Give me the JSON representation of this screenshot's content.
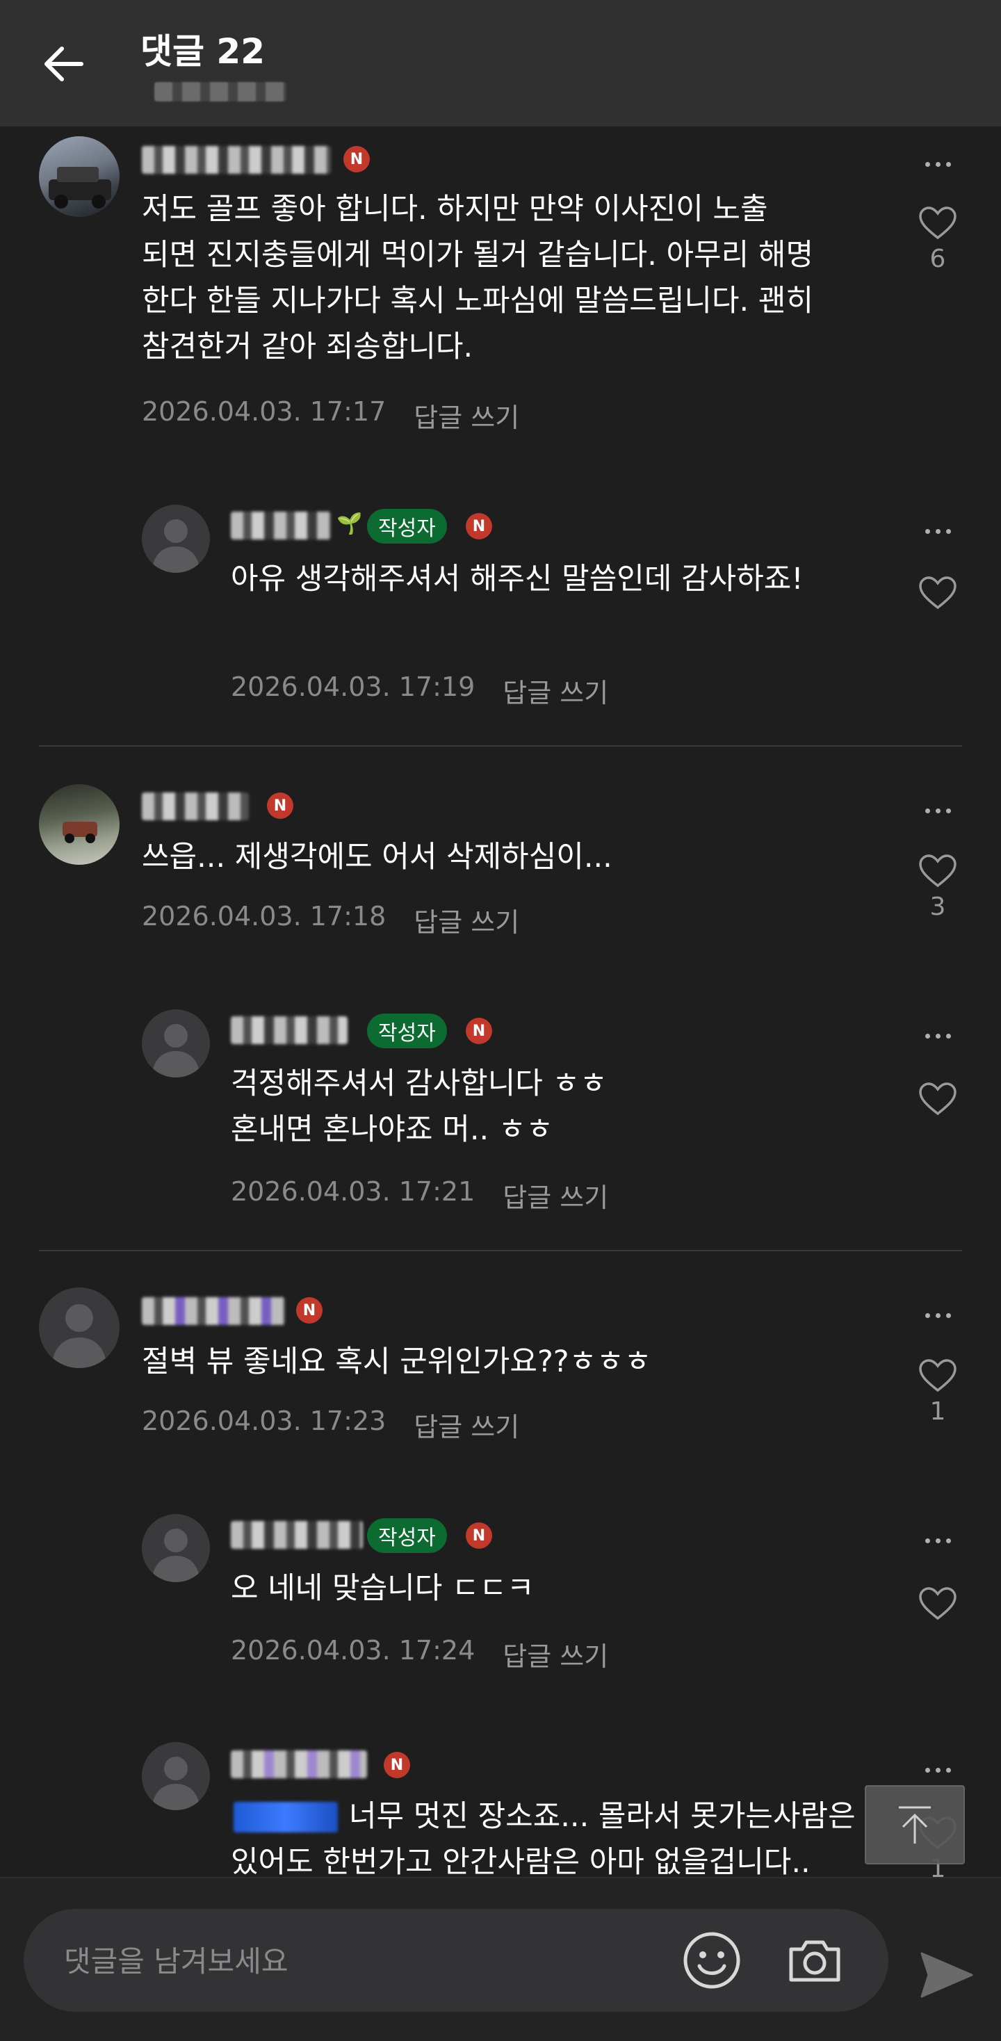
{
  "header": {
    "title": "댓글 22"
  },
  "comments": [
    {
      "text": "저도 골프 좋아 합니다. 하지만 만약 이사진이 노출\n되면 진지충들에게 먹이가 될거 같습니다. 아무리 해명\n한다 한들 지나가다 혹시 노파심에 말씀드립니다. 괜히\n참견한거 같아 죄송합니다.",
      "date": "2026.04.03. 17:17",
      "reply": "답글 쓰기",
      "likes": "6"
    },
    {
      "badge": "작성자",
      "text": "아유 생각해주셔서 해주신 말씀인데 감사하죠!",
      "date": "2026.04.03. 17:19",
      "reply": "답글 쓰기",
      "likes": ""
    },
    {
      "text": "쓰읍... 제생각에도 어서 삭제하심이...",
      "date": "2026.04.03. 17:18",
      "reply": "답글 쓰기",
      "likes": "3"
    },
    {
      "badge": "작성자",
      "text": "걱정해주셔서 감사합니다 ㅎㅎ\n혼내면 혼나야죠 머.. ㅎㅎ",
      "date": "2026.04.03. 17:21",
      "reply": "답글 쓰기",
      "likes": ""
    },
    {
      "text": "절벽 뷰 좋네요 혹시 군위인가요??ㅎㅎㅎ",
      "date": "2026.04.03. 17:23",
      "reply": "답글 쓰기",
      "likes": "1"
    },
    {
      "badge": "작성자",
      "text": "오 네네 맞습니다 ㄷㄷㅋ",
      "date": "2026.04.03. 17:24",
      "reply": "답글 쓰기",
      "likes": ""
    },
    {
      "text": "너무 멋진 장소죠... 몰라서 못가는사람은\n있어도 한번가고 안간사람은 아마 없을겁니다..",
      "likes": "1"
    }
  ],
  "input": {
    "placeholder": "댓글을 남겨보세요"
  },
  "icons": {
    "back": "arrow-left-icon",
    "more": "more-dots-icon",
    "like": "heart-outline-icon",
    "emoji": "smile-icon",
    "camera": "camera-icon",
    "send": "send-icon",
    "top": "scroll-top-icon"
  },
  "colors": {
    "background": "#1e1e1f",
    "header": "#303031",
    "author_badge": "#0b6b31",
    "naver_badge": "#c0392b",
    "meta": "#8a8a8a"
  }
}
